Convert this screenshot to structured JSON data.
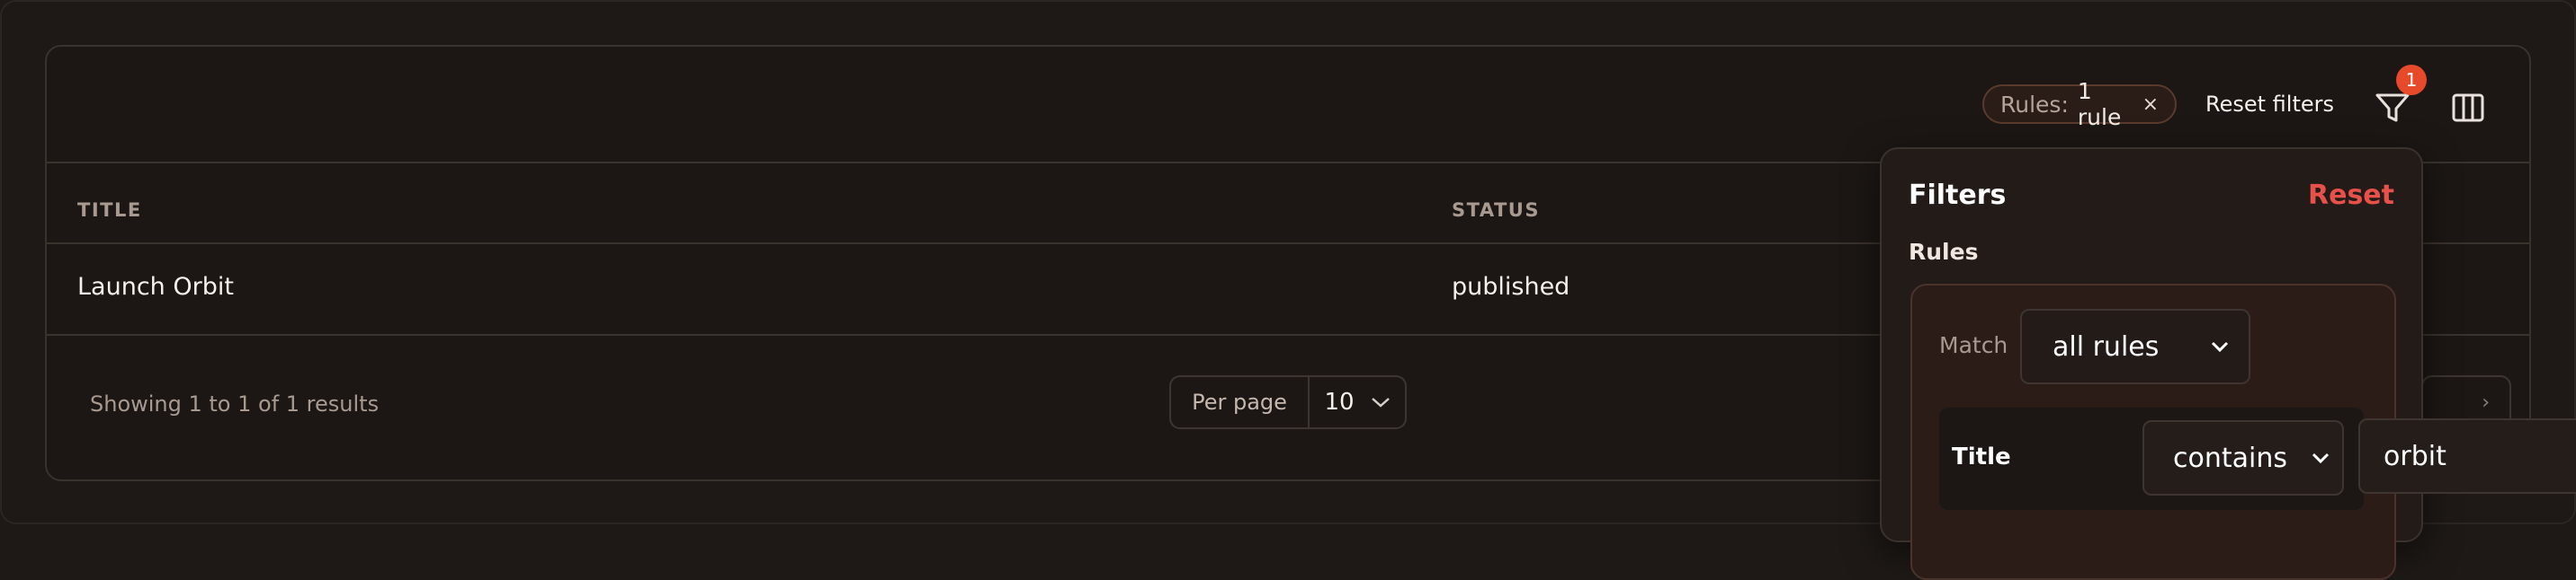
{
  "toolbar": {
    "chip_key": "Rules:",
    "chip_value": "1 rule",
    "chip_remove": "×",
    "reset_filters": "Reset filters",
    "filter_badge": "1"
  },
  "table": {
    "columns": [
      "TITLE",
      "STATUS"
    ],
    "rows": [
      {
        "title": "Launch Orbit",
        "status": "published"
      }
    ]
  },
  "footer": {
    "showing": "Showing 1 to 1 of 1 results",
    "per_page_label": "Per page",
    "per_page_value": "10",
    "next_glyph": "›"
  },
  "filter_panel": {
    "title": "Filters",
    "reset": "Reset",
    "rules_label": "Rules",
    "match_label": "Match",
    "match_value": "all rules",
    "rule": {
      "field": "Title",
      "operator": "contains",
      "value": "orbit"
    }
  },
  "colors": {
    "accent_red": "#e8504a",
    "badge": "#e64a2a",
    "background": "#1e1916"
  }
}
